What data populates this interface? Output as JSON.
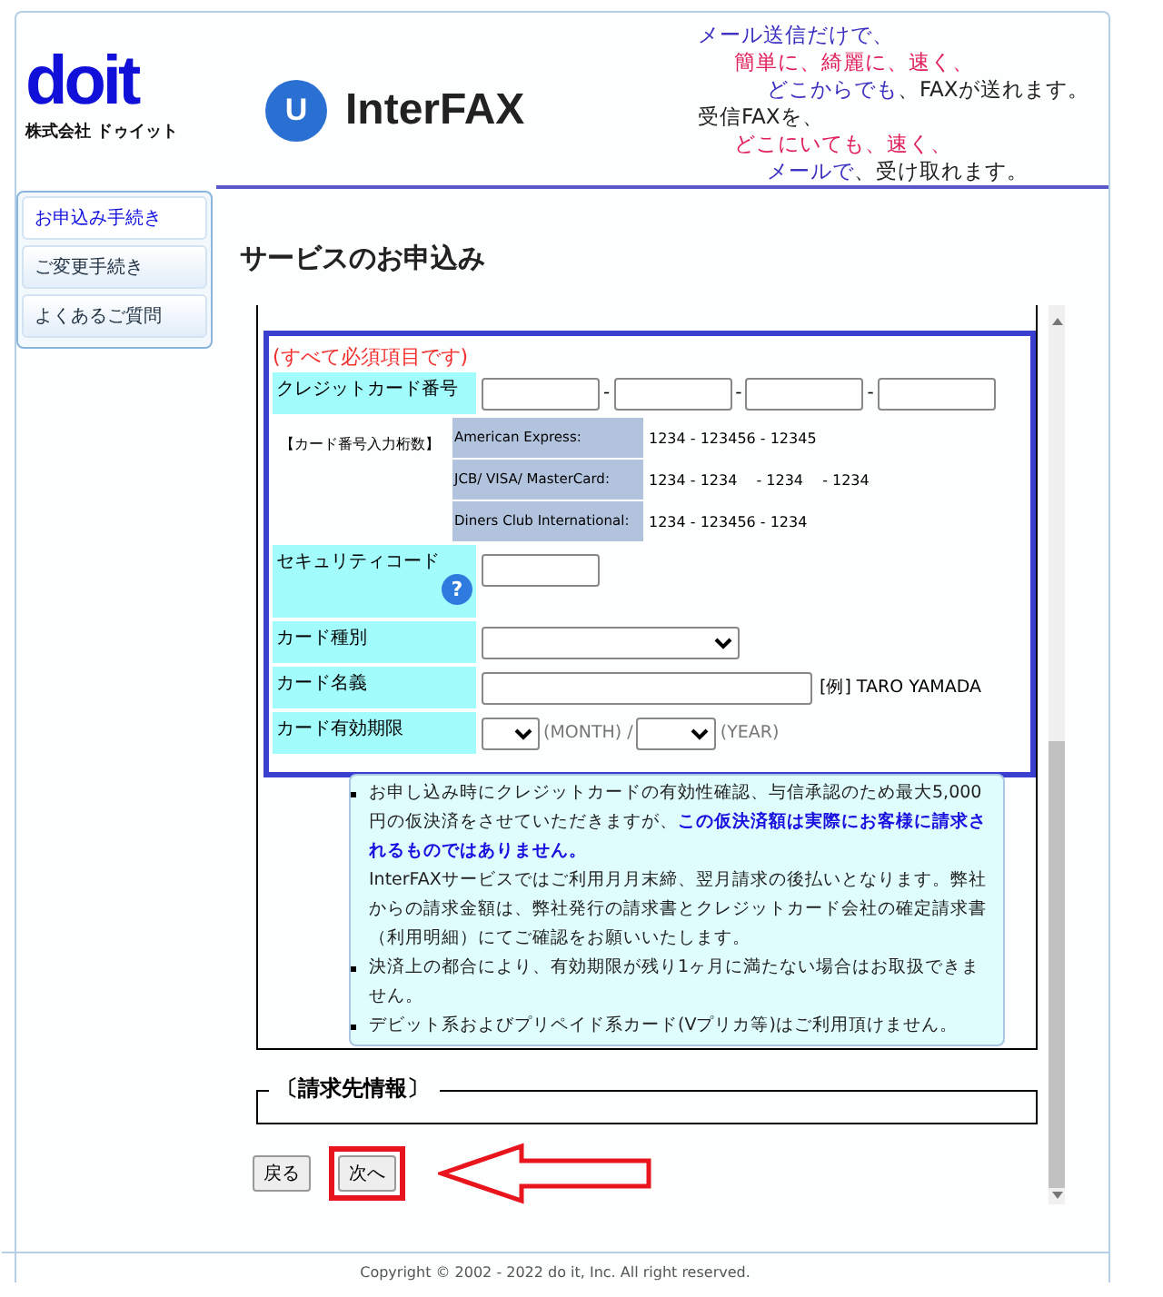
{
  "logo": {
    "wordmark": "doit",
    "company": "株式会社 ドゥイット"
  },
  "product": {
    "glyph": "U",
    "name": "InterFAX"
  },
  "slogan": [
    [
      {
        "text": "メール送信だけで、",
        "color": "#3a2fc0"
      }
    ],
    [
      {
        "text": "簡単に、綺麗に、速く、",
        "color": "#e0205a"
      }
    ],
    [
      {
        "text": "どこからでも",
        "color": "#3a2fc0"
      },
      {
        "text": "、FAXが送れます。",
        "color": "#222222"
      }
    ],
    [
      {
        "text": "受信FAXを、",
        "color": "#222222"
      }
    ],
    [
      {
        "text": "どこにいても、速く、",
        "color": "#e0205a"
      }
    ],
    [
      {
        "text": "メールで",
        "color": "#3a2fc0"
      },
      {
        "text": "、受け取れます。",
        "color": "#222222"
      }
    ]
  ],
  "sidebar": {
    "items": [
      {
        "label": "お申込み手続き",
        "selected": true
      },
      {
        "label": "ご変更手続き",
        "selected": false
      },
      {
        "label": "よくあるご質問",
        "selected": false
      }
    ]
  },
  "page_title": "サービスのお申込み",
  "credit_form": {
    "required_note": "(すべて必須項目です)",
    "card_number": {
      "label": "クレジットカード番号",
      "separators": [
        "-",
        "-",
        "-"
      ]
    },
    "digits_label": "【カード番号入力桁数】",
    "digits": [
      {
        "brand": "American Express:",
        "format": "1234 - 123456 - 12345"
      },
      {
        "brand": "JCB/ VISA/ MasterCard:",
        "format": "1234 - 1234 　- 1234 　- 1234"
      },
      {
        "brand": "Diners Club International:",
        "format": "1234 - 123456 - 1234"
      }
    ],
    "security_code": {
      "label": "セキュリティコード",
      "help_glyph": "?"
    },
    "card_type": {
      "label": "カード種別"
    },
    "card_name": {
      "label": "カード名義",
      "example": "[例] TARO YAMADA"
    },
    "expiry": {
      "label": "カード有効期限",
      "month_unit": "(MONTH) /",
      "year_unit": "(YEAR)"
    }
  },
  "notes": [
    {
      "paragraphs": [
        "お申し込み時にクレジットカードの有効性確認、与信承認のため最大5,000円の仮決済をさせていただきますが、**この仮決済額は実際にお客様に請求されるものではありません。**",
        "InterFAXサービスではご利用月月末締、翌月請求の後払いとなります。弊社からの請求金額は、弊社発行の請求書とクレジットカード会社の確定請求書（利用明細）にてご確認をお願いいたします。"
      ]
    },
    {
      "paragraphs": [
        "決済上の都合により、有効期限が残り1ヶ月に満たない場合はお取扱できません。"
      ]
    },
    {
      "paragraphs": [
        "デビット系およびプリペイド系カード(Vプリカ等)はご利用頂けません。"
      ]
    }
  ],
  "billing_legend": "〔請求先情報〕",
  "buttons": [
    {
      "label": "戻る",
      "highlighted": false
    },
    {
      "label": "次へ",
      "highlighted": true
    }
  ],
  "copyright": "Copyright © 2002 - 2022 do it, Inc. All right reserved."
}
